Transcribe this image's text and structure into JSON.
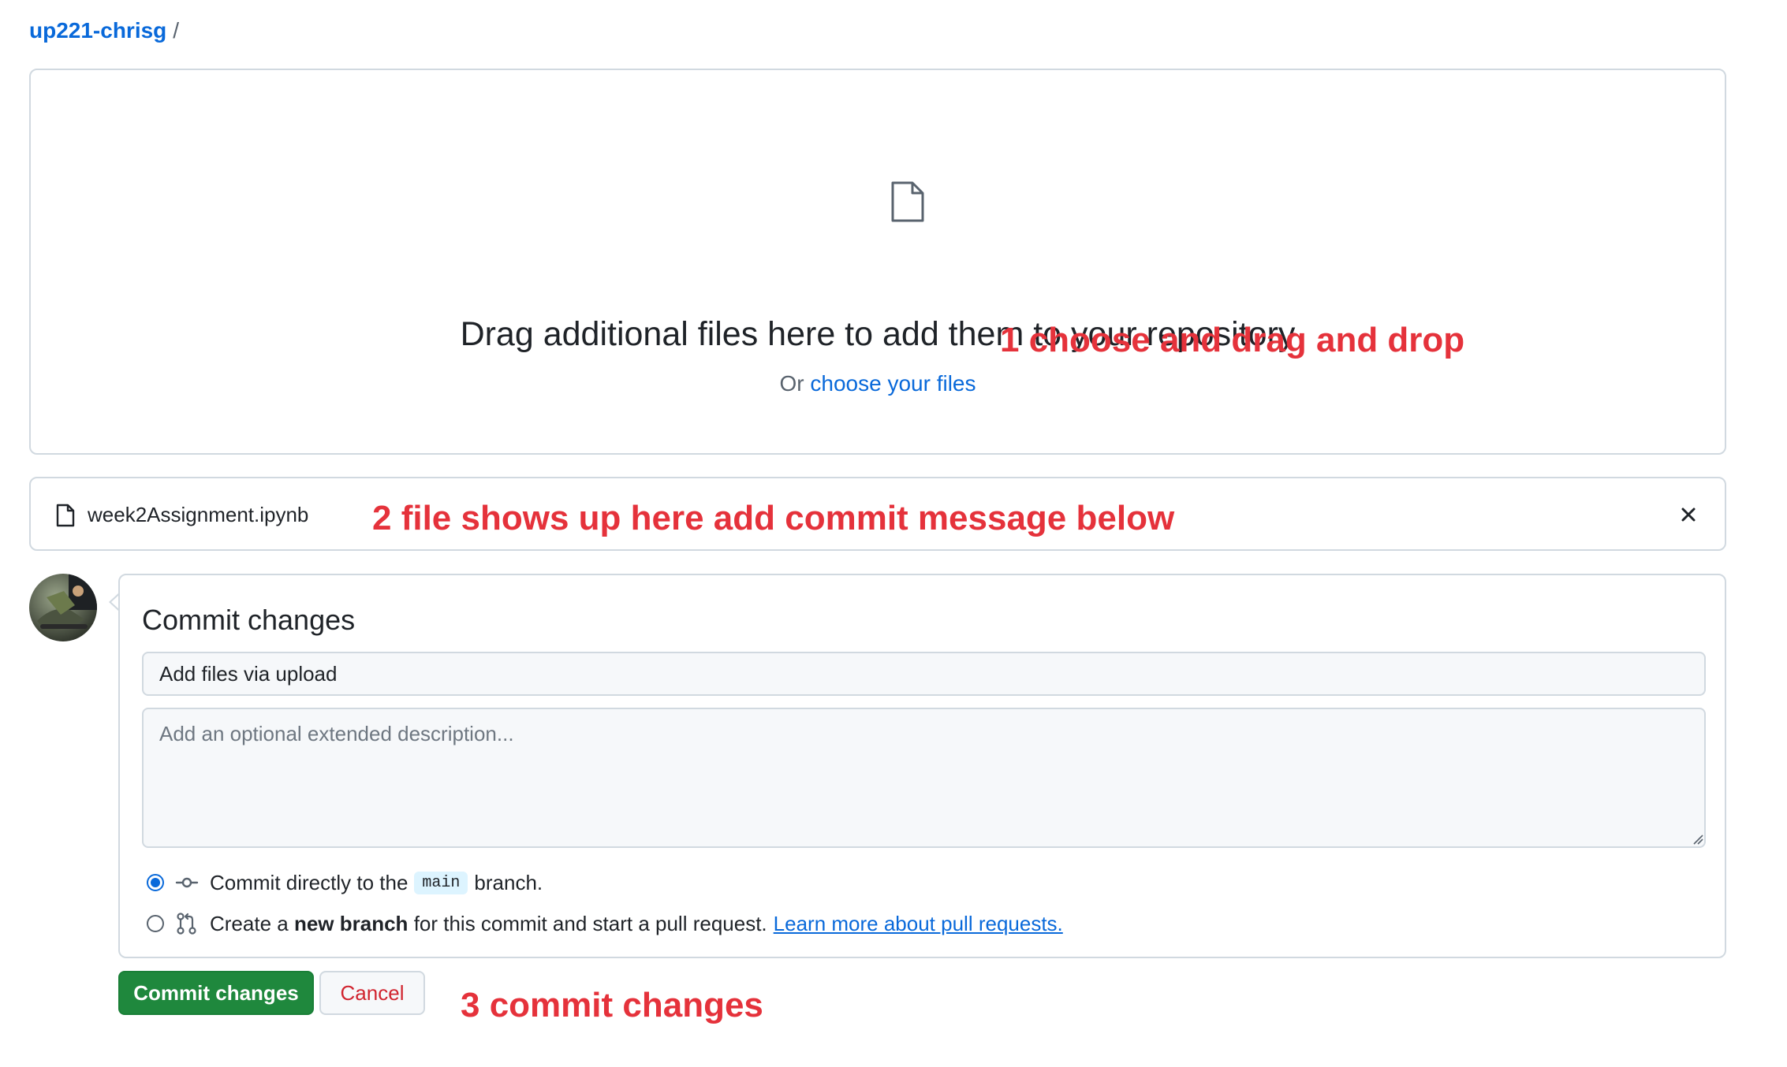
{
  "breadcrumb": {
    "owner": "up221-chrisg",
    "separator": "/"
  },
  "dropzone": {
    "title": "Drag additional files here to add them to your repository",
    "prefix": "Or ",
    "choose_link": "choose your files",
    "icon": "file-icon"
  },
  "annotations": {
    "step1": "1 choose and drag and drop",
    "step2": "2 file shows up here add commit message below",
    "step3": "3 commit changes",
    "color": "#e5323b"
  },
  "file": {
    "name": "week2Assignment.ipynb",
    "icon": "file-icon",
    "remove_icon": "close-icon"
  },
  "commit": {
    "title": "Commit changes",
    "summary_value": "Add files via upload",
    "description_placeholder": "Add an optional extended description...",
    "option_direct": {
      "before": "Commit directly to the",
      "branch": "main",
      "after": "branch.",
      "checked": true,
      "icon": "git-commit-icon"
    },
    "option_new": {
      "before": "Create a",
      "bold": "new branch",
      "after": "for this commit and start a pull request.",
      "link": "Learn more about pull requests.",
      "checked": false,
      "icon": "git-pull-request-icon"
    }
  },
  "buttons": {
    "commit": "Commit changes",
    "cancel": "Cancel"
  },
  "colors": {
    "link": "#0969da",
    "primary": "#1f883d",
    "danger": "#d1242f",
    "border": "#d1d9e0"
  }
}
